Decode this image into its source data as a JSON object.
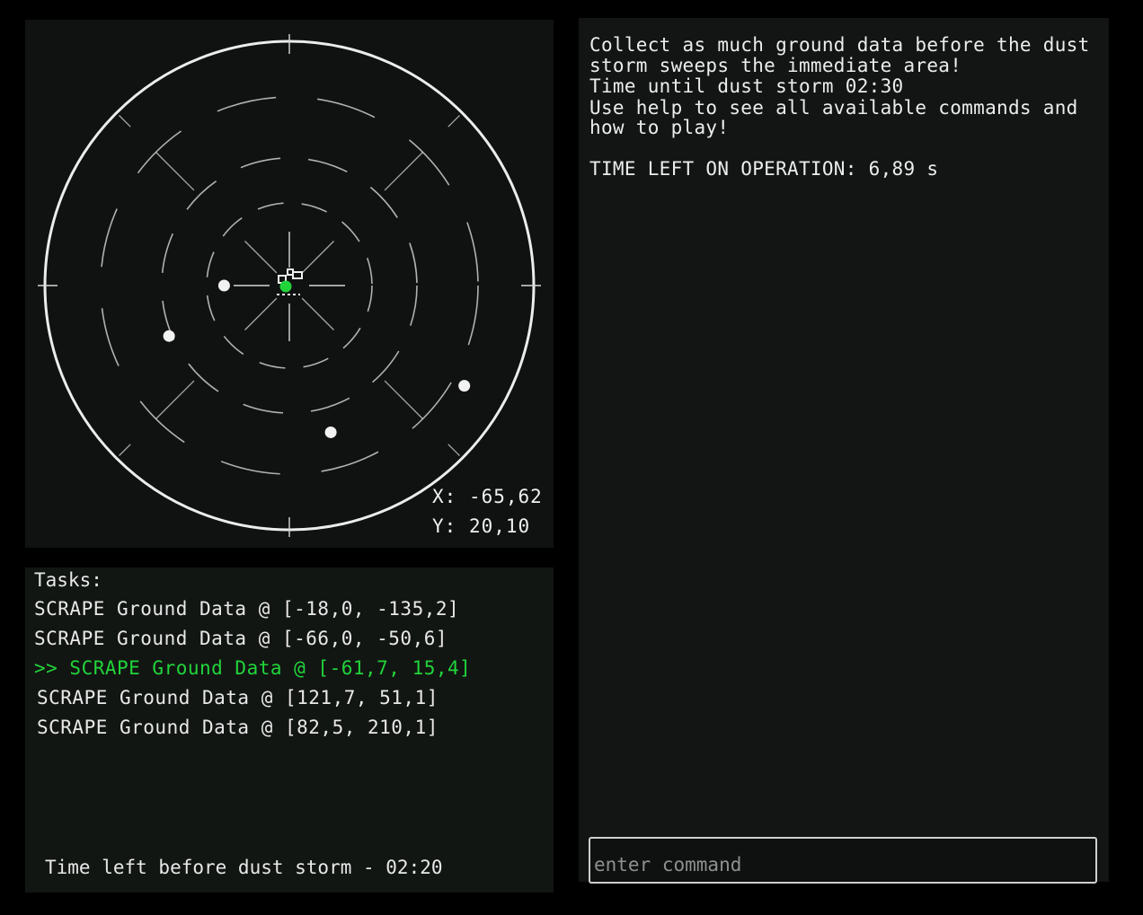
{
  "radar": {
    "player_x": "-65,62",
    "player_y": "20,10",
    "x_label": "X:",
    "y_label": "Y:",
    "accent_color": "#21d43a",
    "line_color": "#d8d8d8",
    "rover_icon": "rover-icon",
    "markers": [
      {
        "name": "ground-data-marker",
        "x_m": -66.0,
        "y_m": 0.0
      },
      {
        "name": "ground-data-marker",
        "x_m": -121.7,
        "y_m": -51.1
      },
      {
        "name": "ground-data-marker",
        "x_m": 177.0,
        "y_m": -101.5
      },
      {
        "name": "ground-data-marker",
        "x_m": 41.9,
        "y_m": -148.6
      }
    ]
  },
  "tasks": {
    "heading": "Tasks:",
    "items": [
      {
        "text": "SCRAPE Ground Data @ [-18,0, -135,2]",
        "active": false
      },
      {
        "text": "SCRAPE Ground Data @ [-66,0, -50,6]",
        "active": false
      },
      {
        "text": ">> SCRAPE Ground Data @ [-61,7, 15,4]",
        "active": true
      },
      {
        "text": "SCRAPE Ground Data @ [121,7, 51,1]",
        "active": false
      },
      {
        "text": "SCRAPE Ground Data @ [82,5, 210,1]",
        "active": false
      }
    ],
    "storm_footer": "Time left before dust storm - 02:20"
  },
  "console": {
    "lines": [
      "Collect as much ground data before the dust",
      "storm sweeps the immediate area!",
      "Time until dust storm 02:30",
      "Use help to see all available commands and",
      "how to play!"
    ],
    "operation_time": "TIME LEFT ON OPERATION: 6,89 s"
  },
  "command": {
    "placeholder": "enter command"
  }
}
